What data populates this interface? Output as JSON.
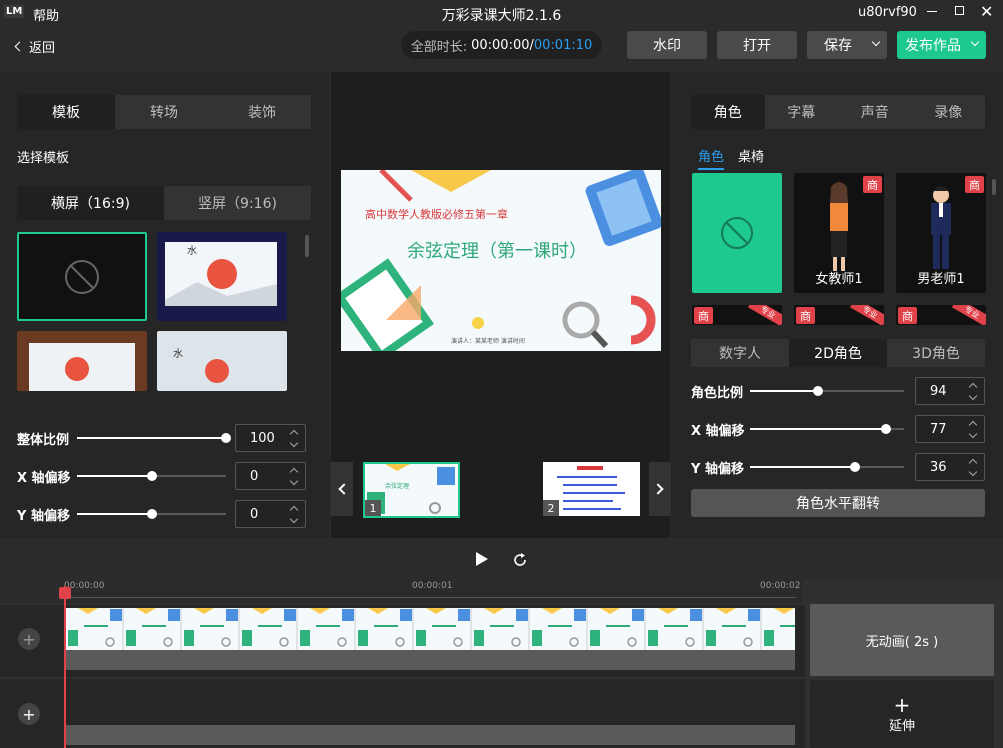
{
  "app": {
    "logo": "LM",
    "menu_help": "帮助",
    "title": "万彩录课大师2.1.6",
    "username": "u80rvf90"
  },
  "toolbar": {
    "back": "返回",
    "duration_label": "全部时长:",
    "duration_current": "00:00:00/",
    "duration_total": "00:01:10",
    "watermark": "水印",
    "open": "打开",
    "save": "保存",
    "publish": "发布作品"
  },
  "left": {
    "tabs": [
      "模板",
      "转场",
      "装饰"
    ],
    "active_tab": 0,
    "section_title": "选择模板",
    "screen_tabs": [
      "横屏（16:9)",
      "竖屏（9:16)"
    ],
    "sliders": [
      {
        "label": "整体比例",
        "value": "100",
        "frac": 1.0
      },
      {
        "label": "X 轴偏移",
        "value": "0",
        "frac": 0.5
      },
      {
        "label": "Y 轴偏移",
        "value": "0",
        "frac": 0.5
      }
    ]
  },
  "slide": {
    "subtitle": "高中数学人教版必修五第一章",
    "title": "余弦定理（第一课时）",
    "footer": "演讲人：某某老师 演讲时间"
  },
  "pages": [
    {
      "num": "1"
    },
    {
      "num": "2"
    }
  ],
  "right": {
    "tabs": [
      "角色",
      "字幕",
      "声音",
      "录像"
    ],
    "sub_tabs": [
      "角色",
      "桌椅"
    ],
    "badge": "商",
    "pro": "专业",
    "roles": [
      "女教师1",
      "男老师1"
    ],
    "type_tabs": [
      "数字人",
      "2D角色",
      "3D角色"
    ],
    "sliders": [
      {
        "label": "角色比例",
        "value": "94",
        "frac": 0.44
      },
      {
        "label": "X 轴偏移",
        "value": "77",
        "frac": 0.88
      },
      {
        "label": "Y 轴偏移",
        "value": "36",
        "frac": 0.68
      }
    ],
    "flip": "角色水平翻转"
  },
  "timeline": {
    "ticks": [
      "00:00:00",
      "00:00:01",
      "00:00:02"
    ],
    "anim": "无动画( 2s )",
    "extend": "延伸",
    "add": "+"
  }
}
